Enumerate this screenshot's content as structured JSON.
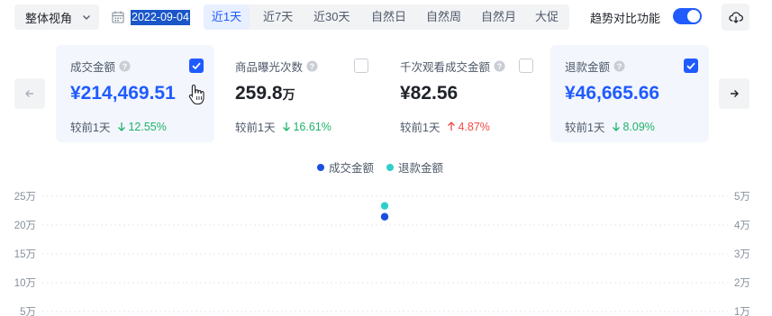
{
  "toolbar": {
    "view_select": {
      "label": "整体视角",
      "icon": "chevron-down-icon"
    },
    "date": {
      "icon": "calendar-icon",
      "value": "2022-09-04"
    },
    "range_tabs": [
      {
        "label": "近1天",
        "active": true
      },
      {
        "label": "近7天",
        "active": false
      },
      {
        "label": "近30天",
        "active": false
      },
      {
        "label": "自然日",
        "active": false
      },
      {
        "label": "自然周",
        "active": false
      },
      {
        "label": "自然月",
        "active": false
      },
      {
        "label": "大促",
        "active": false
      }
    ],
    "compare_toggle": {
      "label": "趋势对比功能",
      "on": true
    },
    "download_icon": "cloud-download-icon"
  },
  "cards": [
    {
      "title": "成交金额",
      "value": "¥214,469.51",
      "unit": "",
      "checked": true,
      "selected": true,
      "value_color": "#1f5bff",
      "compare_label": "较前1天",
      "change": "12.55%",
      "direction": "down"
    },
    {
      "title": "商品曝光次数",
      "value": "259.8",
      "unit": "万",
      "checked": false,
      "selected": false,
      "value_color": "#1f2329",
      "compare_label": "较前1天",
      "change": "16.61%",
      "direction": "down"
    },
    {
      "title": "千次观看成交金额",
      "value": "¥82.56",
      "unit": "",
      "checked": false,
      "selected": false,
      "value_color": "#1f2329",
      "compare_label": "较前1天",
      "change": "4.87%",
      "direction": "up"
    },
    {
      "title": "退款金额",
      "value": "¥46,665.66",
      "unit": "",
      "checked": true,
      "selected": true,
      "value_color": "#1f5bff",
      "compare_label": "较前1天",
      "change": "8.09%",
      "direction": "down"
    }
  ],
  "colors": {
    "accent": "#1f5bff",
    "down": "#1fb36b",
    "up": "#f04a46",
    "series_1": "#1a4fe0",
    "series_2": "#2ecfc9"
  },
  "chart_data": {
    "type": "scatter",
    "series": [
      {
        "name": "成交金额",
        "color": "#1a4fe0",
        "axis": "left",
        "values": [
          214469.51
        ]
      },
      {
        "name": "退款金额",
        "color": "#2ecfc9",
        "axis": "right",
        "values": [
          46665.66
        ]
      }
    ],
    "y_left_ticks": [
      "25万",
      "20万",
      "15万",
      "10万",
      "5万"
    ],
    "y_right_ticks": [
      "5万",
      "4万",
      "3万",
      "2万",
      "1万"
    ],
    "y_left_range": [
      0,
      250000
    ],
    "y_right_range": [
      0,
      50000
    ],
    "grid": true,
    "legend_position": "top"
  }
}
